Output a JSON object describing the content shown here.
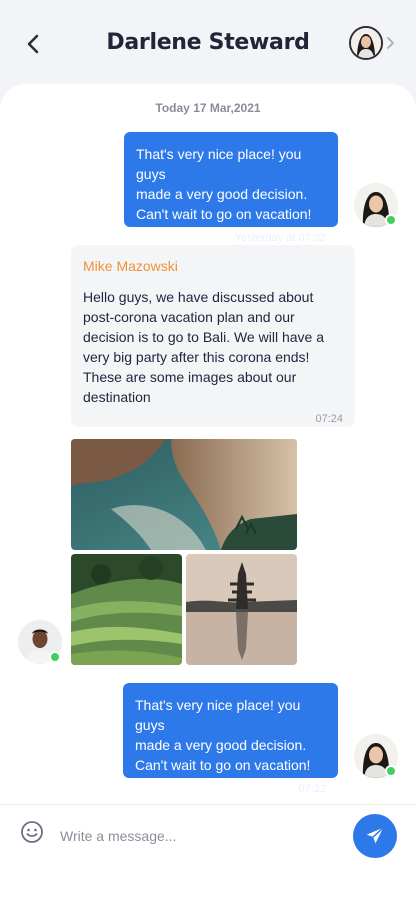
{
  "header": {
    "title": "Darlene Steward",
    "back_icon": "chevron-left-icon",
    "more_icon": "chevron-right-icon"
  },
  "chat": {
    "date": "Today 17 Mar,2021",
    "messages": [
      {
        "direction": "outgoing",
        "lines": [
          "That's very nice place! you guys",
          "made a very good decision.",
          "Can't wait to go on vacation!"
        ],
        "time": "Yesterday at 07:32"
      },
      {
        "direction": "incoming",
        "sender": "Mike Mazowski",
        "text": "Hello guys, we have discussed about post-corona vacation plan and our decision is to go to Bali. We will have a very big party after this corona ends! These are some images about our destination",
        "time": "07:24"
      },
      {
        "direction": "outgoing",
        "lines": [
          "That's very nice place! you guys",
          "made a very good decision.",
          "Can't wait to go on vacation!"
        ],
        "time": "07:32"
      }
    ],
    "photos": [
      "beach-cliff-photo",
      "rice-terrace-photo",
      "temple-lake-photo"
    ]
  },
  "composer": {
    "placeholder": "Write a message...",
    "emoji_icon": "smiley-icon",
    "send_icon": "paper-plane-icon"
  },
  "colors": {
    "accent": "#2e79ea",
    "sender_name": "#f0913a",
    "online": "#3ed25d"
  }
}
